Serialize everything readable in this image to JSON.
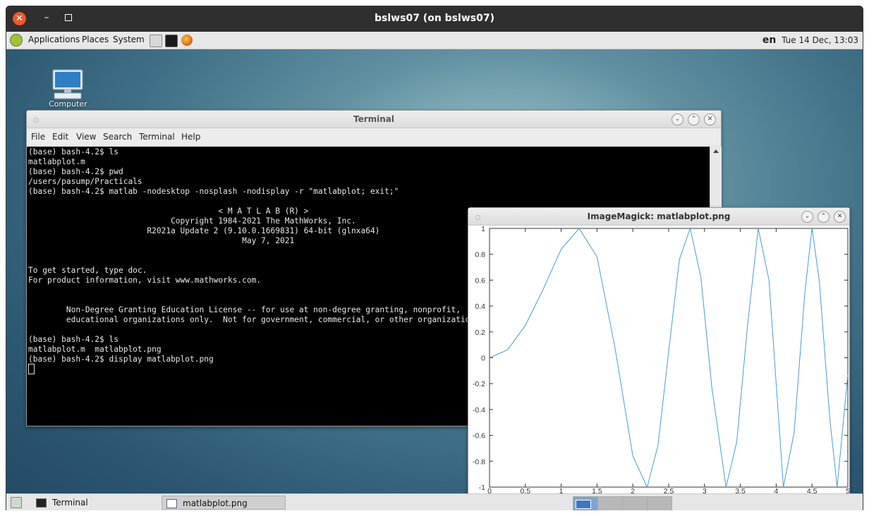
{
  "outer_window": {
    "title": "bslws07 (on bslws07)"
  },
  "top_panel": {
    "menus": [
      "Applications",
      "Places",
      "System"
    ],
    "lang": "en",
    "clock": "Tue 14 Dec, 13:03"
  },
  "desktop": {
    "computer_label": "Computer"
  },
  "terminal": {
    "title": "Terminal",
    "menus": [
      "File",
      "Edit",
      "View",
      "Search",
      "Terminal",
      "Help"
    ],
    "lines": [
      "(base) bash-4.2$ ls",
      "matlabplot.m",
      "(base) bash-4.2$ pwd",
      "/users/pasump/Practicals",
      "(base) bash-4.2$ matlab -nodesktop -nosplash -nodisplay -r \"matlabplot; exit;\"",
      "",
      "                                        < M A T L A B (R) >",
      "                              Copyright 1984-2021 The MathWorks, Inc.",
      "                         R2021a Update 2 (9.10.0.1669831) 64-bit (glnxa64)",
      "                                             May 7, 2021",
      "",
      "",
      "To get started, type doc.",
      "For product information, visit www.mathworks.com.",
      "",
      "",
      "        Non-Degree Granting Education License -- for use at non-degree granting, nonprofit,",
      "        educational organizations only.  Not for government, commercial, or other organizational use.",
      "",
      "(base) bash-4.2$ ls",
      "matlabplot.m  matlabplot.png",
      "(base) bash-4.2$ display matlabplot.png"
    ]
  },
  "imagemagick": {
    "title": "ImageMagick: matlabplot.png"
  },
  "chart_data": {
    "type": "line",
    "title": "",
    "xlabel": "",
    "ylabel": "",
    "xlim": [
      0,
      5
    ],
    "ylim": [
      -1,
      1
    ],
    "xticks": [
      "0",
      "0.5",
      "1",
      "1.5",
      "2",
      "2.5",
      "3",
      "3.5",
      "4",
      "4.5",
      "5"
    ],
    "yticks": [
      "-1",
      "-0.8",
      "-0.6",
      "-0.4",
      "-0.2",
      "0",
      "0.2",
      "0.4",
      "0.6",
      "0.8",
      "1"
    ],
    "grid": false,
    "line_color": "#4a9bd0",
    "series": [
      {
        "x": [
          0,
          0.25,
          0.5,
          0.75,
          1.0,
          1.25,
          1.5,
          1.75,
          2.0,
          2.2,
          2.35,
          2.5,
          2.65,
          2.8,
          2.95,
          3.1,
          3.3,
          3.45,
          3.6,
          3.75,
          3.9,
          4.1,
          4.25,
          4.4,
          4.5,
          4.6,
          4.75,
          4.85,
          5.0
        ],
        "y": [
          0,
          0.06,
          0.25,
          0.53,
          0.84,
          1.0,
          0.78,
          0.08,
          -0.76,
          -1.0,
          -0.68,
          0.05,
          0.76,
          1.0,
          0.62,
          -0.22,
          -1.0,
          -0.65,
          0.25,
          1.0,
          0.6,
          -1.0,
          -0.58,
          0.5,
          1.0,
          0.6,
          -0.48,
          -1.0,
          -0.13
        ]
      }
    ]
  },
  "bottom_panel": {
    "tasks": [
      "Terminal",
      "matlabplot.png"
    ]
  }
}
